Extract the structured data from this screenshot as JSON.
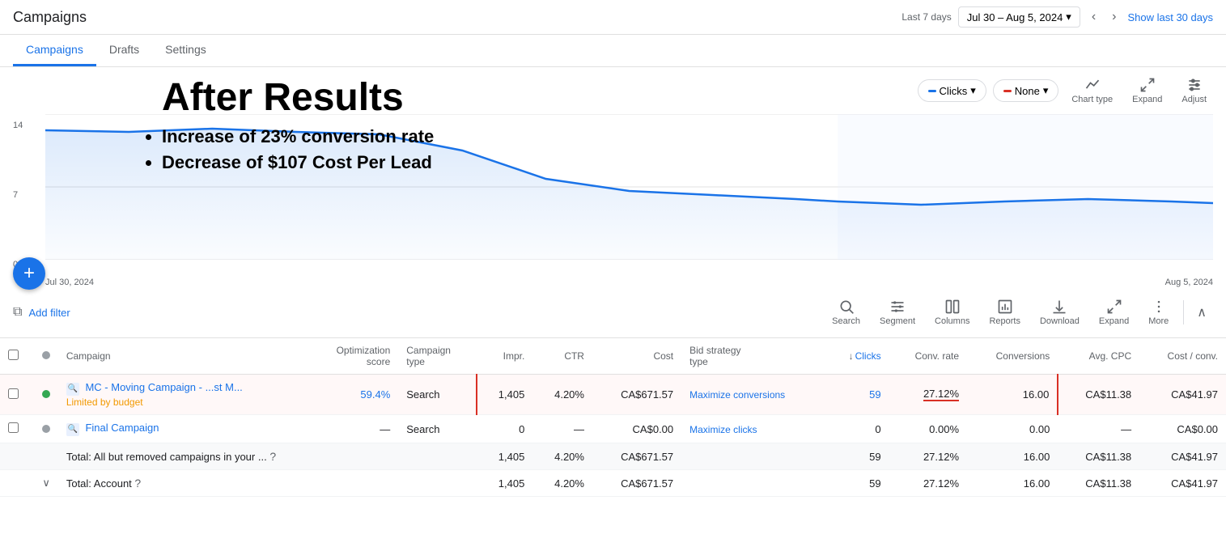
{
  "page": {
    "title": "Campaigns"
  },
  "topbar": {
    "date_label": "Last 7 days",
    "date_range": "Jul 30 – Aug 5, 2024",
    "show_last": "Show last 30 days"
  },
  "tabs": [
    {
      "label": "Campaigns",
      "active": true
    },
    {
      "label": "Drafts",
      "active": false
    },
    {
      "label": "Settings",
      "active": false
    }
  ],
  "overlay": {
    "heading": "After Results",
    "bullets": [
      "Increase of  23% conversion rate",
      "Decrease of $107 Cost Per Lead"
    ]
  },
  "chart": {
    "metric1": "Clicks",
    "metric2": "None",
    "chart_type_label": "Chart type",
    "expand_label": "Expand",
    "adjust_label": "Adjust",
    "y_labels": [
      "14",
      "7",
      "0"
    ],
    "x_labels": [
      "Jul 30, 2024",
      "Aug 5, 2024"
    ]
  },
  "filter_bar": {
    "add_filter": "Add filter",
    "toolbar_items": [
      {
        "label": "Search",
        "icon": "search"
      },
      {
        "label": "Segment",
        "icon": "segment"
      },
      {
        "label": "Columns",
        "icon": "columns"
      },
      {
        "label": "Reports",
        "icon": "reports"
      },
      {
        "label": "Download",
        "icon": "download"
      },
      {
        "label": "Expand",
        "icon": "expand"
      },
      {
        "label": "More",
        "icon": "more"
      }
    ]
  },
  "table": {
    "columns": [
      {
        "key": "checkbox",
        "label": ""
      },
      {
        "key": "status",
        "label": ""
      },
      {
        "key": "campaign",
        "label": "Campaign",
        "align": "left"
      },
      {
        "key": "opt_score",
        "label": "Optimization score",
        "align": "right"
      },
      {
        "key": "campaign_type",
        "label": "Campaign type",
        "align": "left"
      },
      {
        "key": "impr",
        "label": "Impr.",
        "align": "right"
      },
      {
        "key": "ctr",
        "label": "CTR",
        "align": "right"
      },
      {
        "key": "cost",
        "label": "Cost",
        "align": "right"
      },
      {
        "key": "bid_strategy",
        "label": "Bid strategy type",
        "align": "left"
      },
      {
        "key": "clicks",
        "label": "↓ Clicks",
        "align": "right",
        "sorted": true
      },
      {
        "key": "conv_rate",
        "label": "Conv. rate",
        "align": "right"
      },
      {
        "key": "conversions",
        "label": "Conversions",
        "align": "right"
      },
      {
        "key": "avg_cpc",
        "label": "Avg. CPC",
        "align": "right"
      },
      {
        "key": "cost_conv",
        "label": "Cost / conv.",
        "align": "right"
      }
    ],
    "rows": [
      {
        "id": "row1",
        "status": "green",
        "campaign": "MC - Moving Campaign - ...st M...",
        "campaign_status": "Limited by budget",
        "opt_score": "59.4%",
        "campaign_type": "Search",
        "impr": "1,405",
        "ctr": "4.20%",
        "cost": "CA$671.57",
        "bid_strategy": "Maximize conversions",
        "clicks": "59",
        "conv_rate": "27.12%",
        "conversions": "16.00",
        "avg_cpc": "CA$11.38",
        "cost_conv": "CA$41.97",
        "highlight": true
      },
      {
        "id": "row2",
        "status": "grey",
        "campaign": "Final Campaign",
        "campaign_status": "",
        "opt_score": "—",
        "campaign_type": "Search",
        "impr": "0",
        "ctr": "—",
        "cost": "CA$0.00",
        "bid_strategy": "Maximize clicks",
        "clicks": "0",
        "conv_rate": "0.00%",
        "conversions": "0.00",
        "avg_cpc": "—",
        "cost_conv": "CA$0.00",
        "highlight": false
      }
    ],
    "total_row": {
      "label": "Total: All but removed campaigns in your ...",
      "impr": "1,405",
      "ctr": "4.20%",
      "cost": "CA$671.57",
      "clicks": "59",
      "conv_rate": "27.12%",
      "conversions": "16.00",
      "avg_cpc": "CA$11.38",
      "cost_conv": "CA$41.97"
    },
    "account_row": {
      "label": "Total: Account",
      "impr": "1,405",
      "ctr": "4.20%",
      "cost": "CA$671.57",
      "clicks": "59",
      "conv_rate": "27.12%",
      "conversions": "16.00",
      "avg_cpc": "CA$11.38",
      "cost_conv": "CA$41.97"
    }
  }
}
